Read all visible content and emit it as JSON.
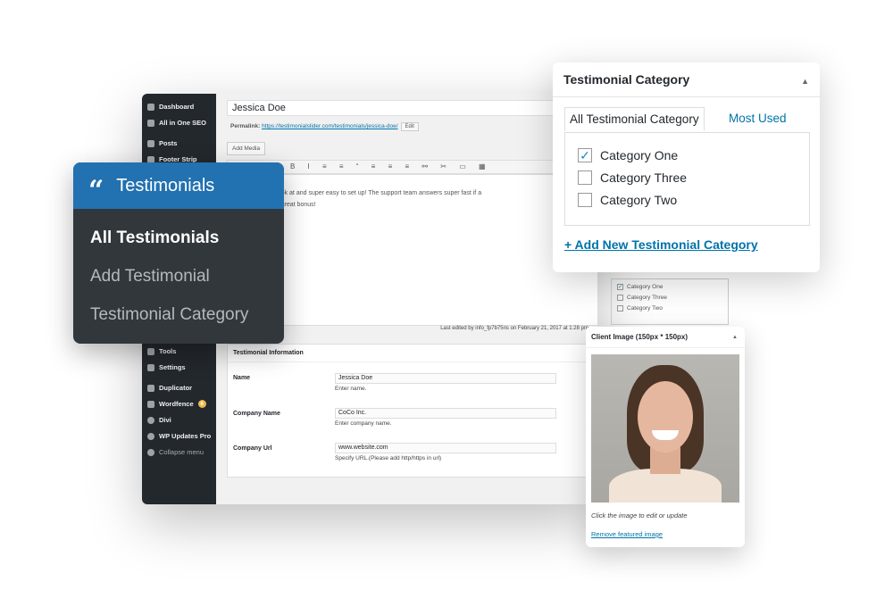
{
  "sidebar": {
    "items": [
      {
        "label": "Dashboard"
      },
      {
        "label": "All in One SEO"
      },
      {
        "label": "Posts"
      },
      {
        "label": "Footer Strip"
      },
      {
        "label": "Tools"
      },
      {
        "label": "Settings"
      },
      {
        "label": "Duplicator"
      },
      {
        "label": "Wordfence",
        "badge": "6"
      },
      {
        "label": "Divi"
      },
      {
        "label": "WP Updates Pro"
      },
      {
        "label": "Collapse menu"
      }
    ]
  },
  "editor": {
    "title": "Jessica Doe",
    "permalink_label": "Permalink:",
    "permalink_url": "https://testimonialslider.com/testimonials/jessica-doe/",
    "edit_label": "Edit",
    "add_media": "Add Media",
    "content_line1": "so gorgeous to look at and super easy to set up! The support team answers super fast if a",
    "content_line2": "raised which is a great bonus!",
    "last_edited": "Last edited by info_fp7b75ns on February 21, 2017 at 1:28 pm"
  },
  "info": {
    "title": "Testimonial Information",
    "fields": [
      {
        "label": "Name",
        "value": "Jessica Doe",
        "hint": "Enter name."
      },
      {
        "label": "Company Name",
        "value": "CoCo Inc.",
        "hint": "Enter company name."
      },
      {
        "label": "Company Url",
        "value": "www.website.com",
        "hint": "Specify URL.(Please add http/https in url)"
      }
    ]
  },
  "menu": {
    "title": "Testimonials",
    "items": [
      {
        "label": "All Testimonials",
        "active": true
      },
      {
        "label": "Add Testimonial"
      },
      {
        "label": "Testimonial Category"
      }
    ],
    "accent": "#2271b1"
  },
  "category": {
    "title": "Testimonial Category",
    "tab_all": "All Testimonial Category",
    "tab_used": "Most Used",
    "items": [
      {
        "label": "Category One",
        "checked": true
      },
      {
        "label": "Category Three",
        "checked": false
      },
      {
        "label": "Category Two",
        "checked": false
      }
    ],
    "add_link": "+ Add New Testimonial Category"
  },
  "client_image": {
    "title": "Client Image (150px * 150px)",
    "caption": "Click the image to edit or update",
    "remove": "Remove featured image"
  }
}
